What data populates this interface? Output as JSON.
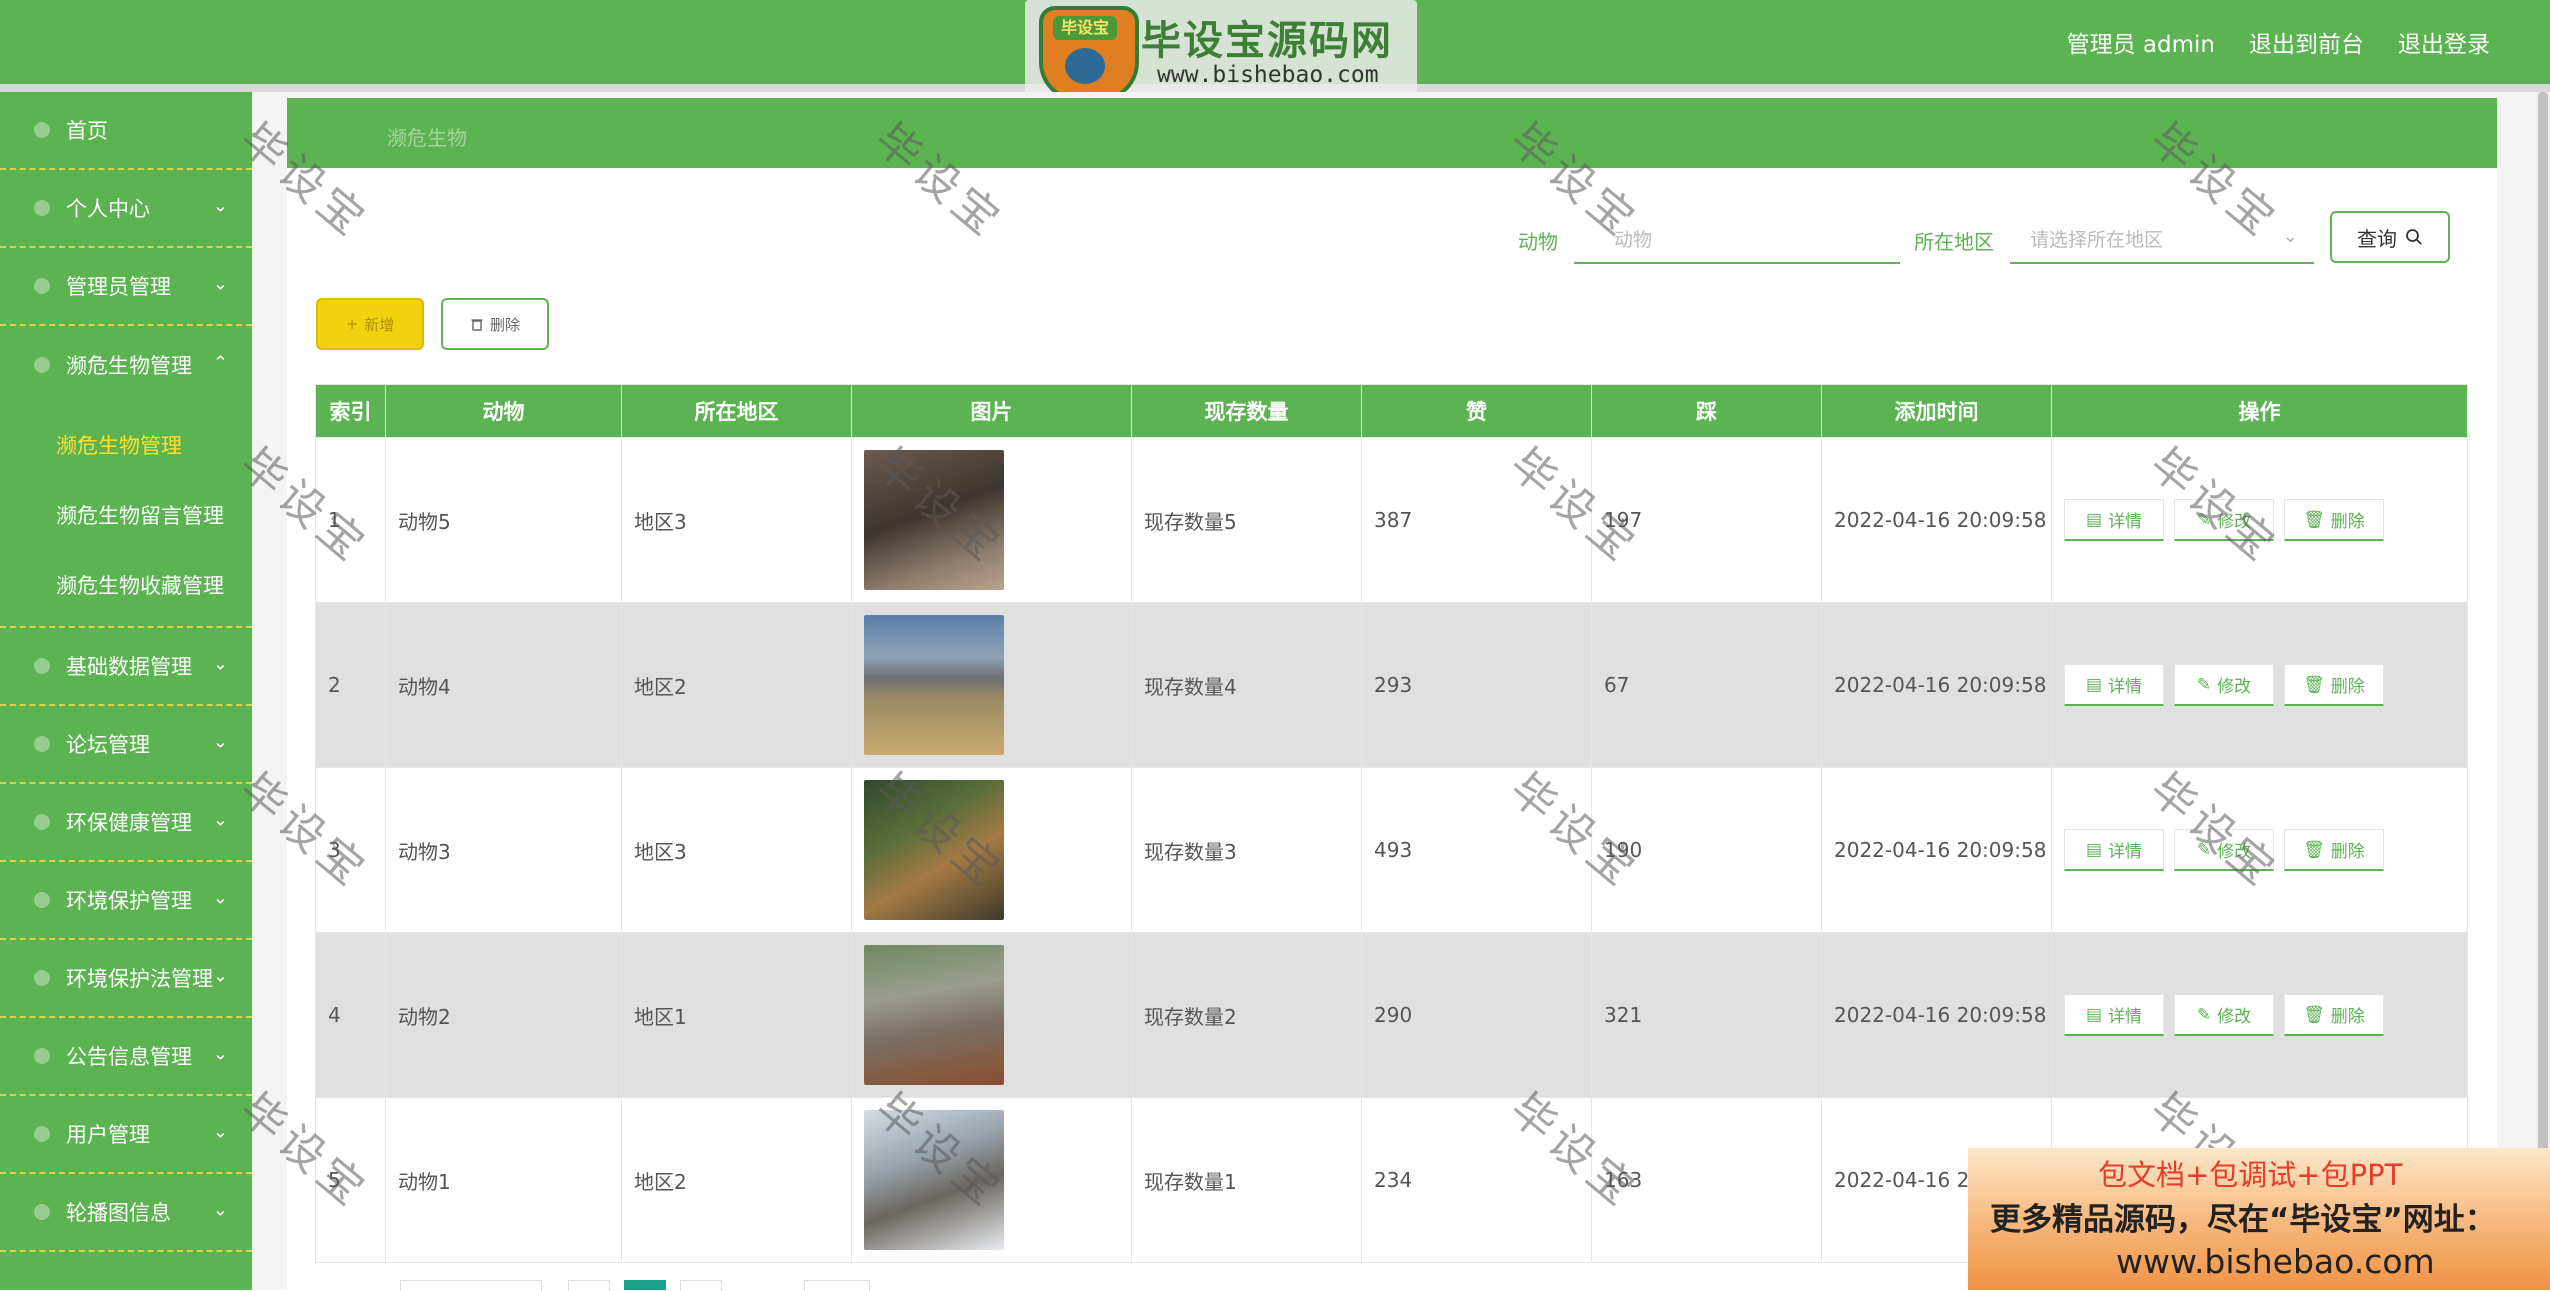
{
  "header": {
    "user_label": "管理员 admin",
    "to_front": "退出到前台",
    "logout": "退出登录"
  },
  "logo": {
    "badge_text": "毕设宝",
    "title": "毕设宝源码网",
    "url": "www.bishebao.com"
  },
  "sidebar": {
    "items": [
      {
        "label": "首页"
      },
      {
        "label": "个人中心"
      },
      {
        "label": "管理员管理"
      },
      {
        "label": "濒危生物管理"
      },
      {
        "label": "基础数据管理"
      },
      {
        "label": "论坛管理"
      },
      {
        "label": "环保健康管理"
      },
      {
        "label": "环境保护管理"
      },
      {
        "label": "环境保护法管理"
      },
      {
        "label": "公告信息管理"
      },
      {
        "label": "用户管理"
      },
      {
        "label": "轮播图信息"
      }
    ],
    "submenu": [
      {
        "label": "濒危生物管理"
      },
      {
        "label": "濒危生物留言管理"
      },
      {
        "label": "濒危生物收藏管理"
      }
    ]
  },
  "breadcrumb": "濒危生物",
  "search": {
    "animal_label": "动物",
    "animal_placeholder": "动物",
    "region_label": "所在地区",
    "region_placeholder": "请选择所在地区",
    "query_label": "查询"
  },
  "toolbar": {
    "add_label": "新增",
    "delete_label": "删除"
  },
  "table": {
    "columns": [
      "索引",
      "动物",
      "所在地区",
      "图片",
      "现存数量",
      "赞",
      "踩",
      "添加时间",
      "操作"
    ],
    "rows": [
      {
        "index": "1",
        "animal": "动物5",
        "region": "地区3",
        "count": "现存数量5",
        "likes": "387",
        "dislikes": "197",
        "time": "2022-04-16 20:09:58"
      },
      {
        "index": "2",
        "animal": "动物4",
        "region": "地区2",
        "count": "现存数量4",
        "likes": "293",
        "dislikes": "67",
        "time": "2022-04-16 20:09:58"
      },
      {
        "index": "3",
        "animal": "动物3",
        "region": "地区3",
        "count": "现存数量3",
        "likes": "493",
        "dislikes": "190",
        "time": "2022-04-16 20:09:58"
      },
      {
        "index": "4",
        "animal": "动物2",
        "region": "地区1",
        "count": "现存数量2",
        "likes": "290",
        "dislikes": "321",
        "time": "2022-04-16 20:09:58"
      },
      {
        "index": "5",
        "animal": "动物1",
        "region": "地区2",
        "count": "现存数量1",
        "likes": "234",
        "dislikes": "163",
        "time": "2022-04-16 20"
      }
    ],
    "ops": {
      "detail": "详情",
      "edit": "修改",
      "delete": "删除"
    }
  },
  "watermark": "毕设宝",
  "ad": {
    "line1": "包文档+包调试+包PPT",
    "line2": "更多精品源码，尽在“毕设宝”网址：",
    "line3": "www.bishebao.com"
  },
  "colors": {
    "primary": "#5cb352",
    "accent_yellow": "#f2d10d",
    "row_alt": "#e0e0e0"
  }
}
